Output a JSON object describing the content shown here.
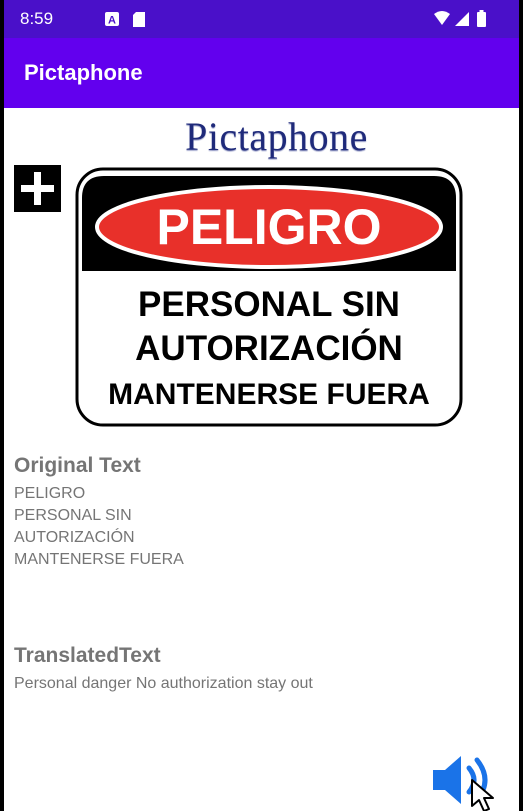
{
  "status_bar": {
    "time": "8:59",
    "notification_icons": [
      "accessibility-a-icon",
      "sd-card-icon"
    ],
    "system_icons": [
      "wifi-icon",
      "cell-signal-icon",
      "battery-icon"
    ]
  },
  "app_bar": {
    "title": "Pictaphone"
  },
  "logo": {
    "text": "Pictaphone"
  },
  "add_button": {
    "icon": "plus-icon"
  },
  "sign": {
    "header": "PELIGRO",
    "line1": "PERSONAL SIN",
    "line2": "AUTORIZACIÓN",
    "line3": "MANTENERSE FUERA"
  },
  "original": {
    "heading": "Original Text",
    "text": "PELIGRO\nPERSONAL SIN\nAUTORIZACIÓN\nMANTENERSE FUERA"
  },
  "translated": {
    "heading": "TranslatedText",
    "text": "Personal danger No authorization stay out"
  },
  "speaker_button": {
    "icon": "speaker-volume-icon"
  },
  "colors": {
    "status_bar": "#4a10c9",
    "app_bar": "#6200ee",
    "speaker_blue": "#1a73e8",
    "sign_red": "#e8302a"
  }
}
